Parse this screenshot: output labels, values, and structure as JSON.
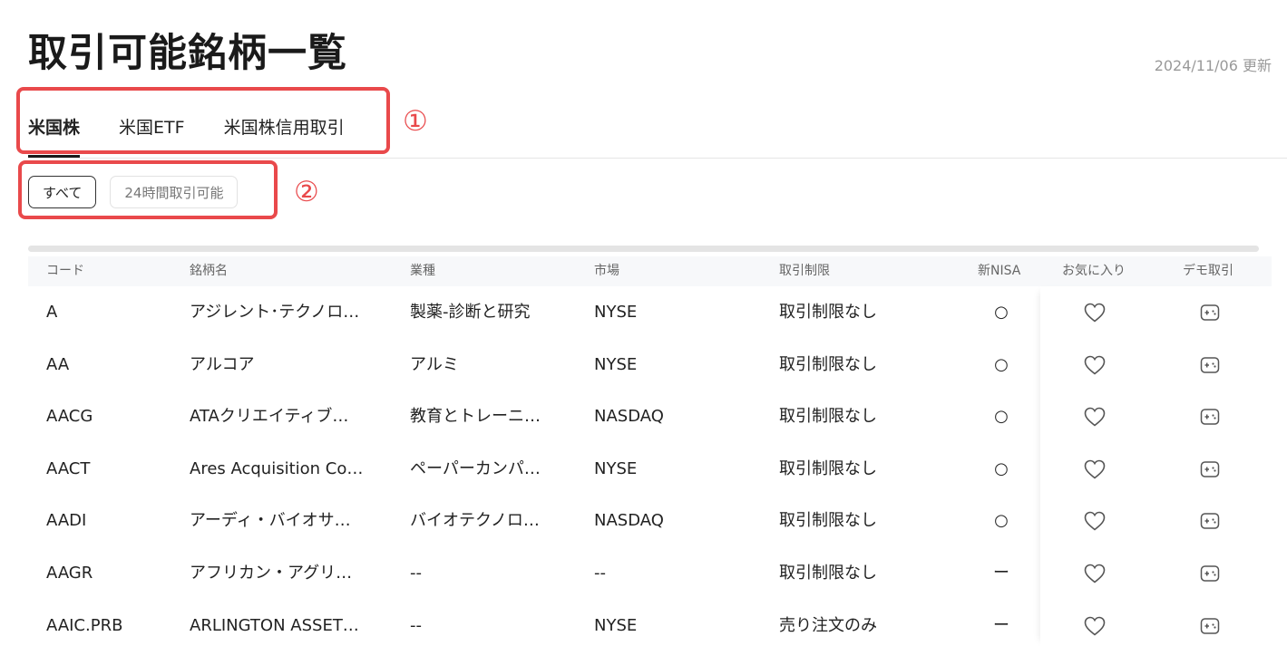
{
  "page": {
    "title": "取引可能銘柄一覧",
    "updated": "2024/11/06 更新"
  },
  "tabs": [
    {
      "label": "米国株",
      "active": true
    },
    {
      "label": "米国ETF",
      "active": false
    },
    {
      "label": "米国株信用取引",
      "active": false
    }
  ],
  "filters": [
    {
      "label": "すべて",
      "active": true
    },
    {
      "label": "24時間取引可能",
      "active": false
    }
  ],
  "annotations": [
    "①",
    "②"
  ],
  "table": {
    "headers": [
      "コード",
      "銘柄名",
      "業種",
      "市場",
      "取引制限",
      "新NISA",
      "お気に入り",
      "デモ取引"
    ],
    "rows": [
      {
        "code": "A",
        "name": "アジレント･テクノロ…",
        "industry": "製薬-診断と研究",
        "market": "NYSE",
        "restriction": "取引制限なし",
        "nisa": "○"
      },
      {
        "code": "AA",
        "name": "アルコア",
        "industry": "アルミ",
        "market": "NYSE",
        "restriction": "取引制限なし",
        "nisa": "○"
      },
      {
        "code": "AACG",
        "name": "ATAクリエイティブ…",
        "industry": "教育とトレーニ…",
        "market": "NASDAQ",
        "restriction": "取引制限なし",
        "nisa": "○"
      },
      {
        "code": "AACT",
        "name": "Ares Acquisition Co…",
        "industry": "ペーパーカンパ…",
        "market": "NYSE",
        "restriction": "取引制限なし",
        "nisa": "○"
      },
      {
        "code": "AADI",
        "name": "アーディ・バイオサ…",
        "industry": "バイオテクノロ…",
        "market": "NASDAQ",
        "restriction": "取引制限なし",
        "nisa": "○"
      },
      {
        "code": "AAGR",
        "name": "アフリカン・アグリ…",
        "industry": "--",
        "market": "--",
        "restriction": "取引制限なし",
        "nisa": "ー"
      },
      {
        "code": "AAIC.PRB",
        "name": "ARLINGTON ASSET…",
        "industry": "--",
        "market": "NYSE",
        "restriction": "売り注文のみ",
        "nisa": "ー"
      }
    ]
  },
  "colors": {
    "annotation": "#e9494b",
    "text": "#222222",
    "muted": "#999999",
    "header_bg": "#f7f8fa"
  },
  "icons": {
    "favorite": "heart-icon",
    "demo": "gamepad-icon"
  }
}
